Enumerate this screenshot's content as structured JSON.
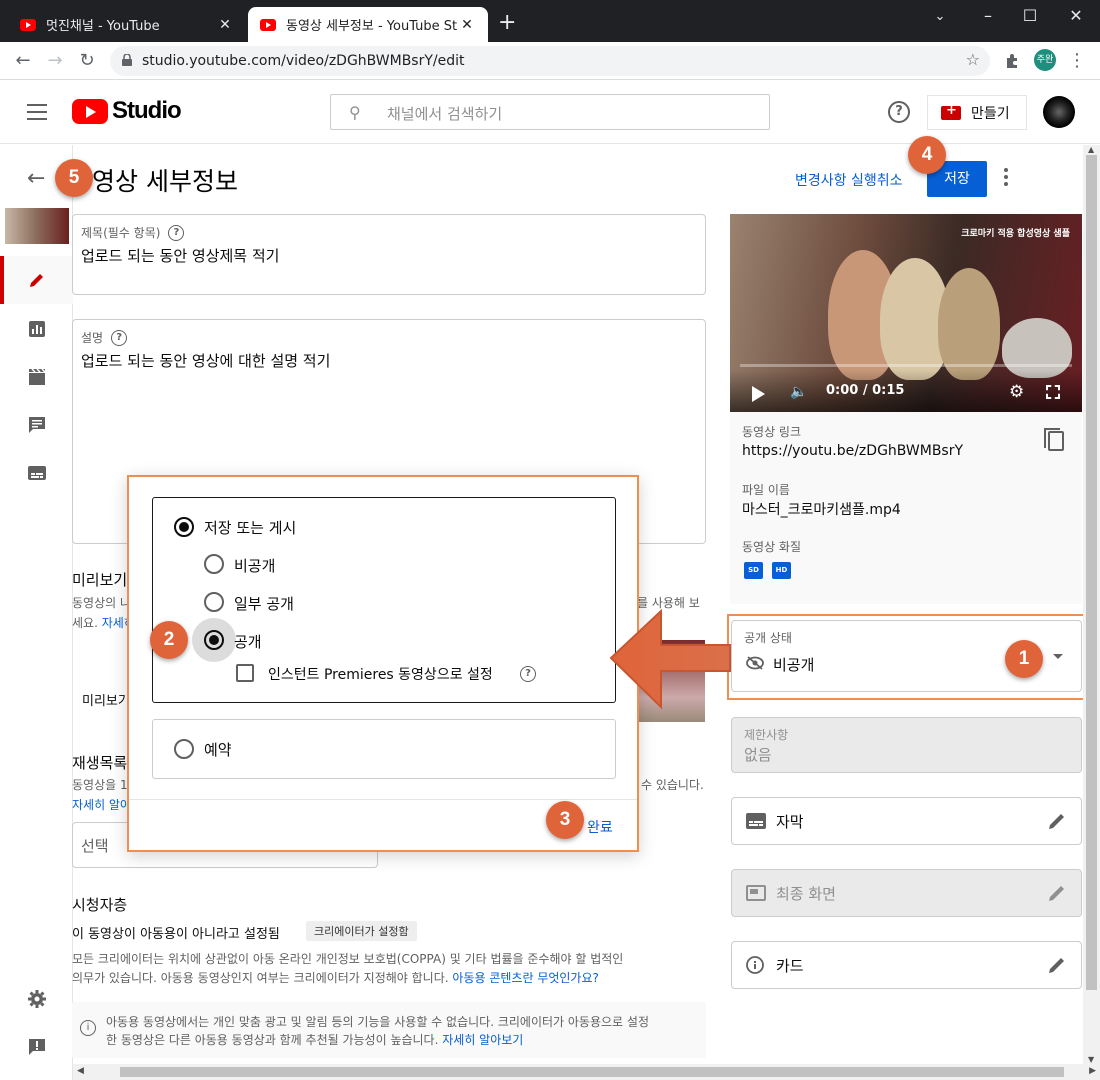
{
  "browser": {
    "tabs": [
      {
        "title": "멋진채널 - YouTube",
        "active": false
      },
      {
        "title": "동영상 세부정보 - YouTube Studio",
        "active": true
      }
    ],
    "url": "studio.youtube.com/video/zDGhBWMBsrY/edit",
    "profile_initials": "주완"
  },
  "header": {
    "logo_text": "Studio",
    "search_placeholder": "채널에서 검색하기",
    "help_icon": "?",
    "create_label": "만들기"
  },
  "page": {
    "title": "영상 세부정보",
    "undo_label": "변경사항 실행취소",
    "save_label": "저장"
  },
  "details": {
    "title_label": "제목(필수 항목)",
    "title_value": "업로드 되는 동안 영상제목 적기",
    "description_label": "설명",
    "description_value": "업로드 되는 동안 영상에 대한 설명 적기"
  },
  "background": {
    "thumbnail_heading_fragment": "미리보기",
    "thumbnail_desc_fragment1": "동영상의 나",
    "thumbnail_desc_fragment2": "를 사용해 보",
    "thumbnail_desc_fragment3": "세요.",
    "thumbnail_learn_fragment": "자세히",
    "thumbnail_preview_fragment": "미리보기",
    "playlist_heading_fragment": "재생목록",
    "playlist_desc_fragment1": "동영상을 1",
    "playlist_desc_fragment2": "수 있습니다.",
    "playlist_learn_fragment": "자세히 알아",
    "playlist_select": "선택",
    "audience_heading_fragment": "시청자층",
    "audience_status": "이 동영상이 아동용이 아니라고 설정됨",
    "audience_chip": "크리에이터가 설정함",
    "audience_desc_line1": "모든 크리에이터는 위치에 상관없이 아동 온라인 개인정보 보호법(COPPA) 및 기타 법률을 준수해야 할 법적인",
    "audience_desc_line2": "의무가 있습니다. 아동용 동영상인지 여부는 크리에이터가 지정해야 합니다.",
    "audience_desc_link": "아동용 콘텐츠란 무엇인가요?",
    "info_line1": "아동용 동영상에서는 개인 맞춤 광고 및 알림 등의 기능을 사용할 수 없습니다. 크리에이터가 아동용으로 설정",
    "info_line2": "한 동영상은 다른 아동용 동영상과 함께 추천될 가능성이 높습니다.",
    "info_link": "자세히 알아보기"
  },
  "video_panel": {
    "overlay_text": "크로마키 적용 합성영상 샘플",
    "time": "0:00 / 0:15",
    "link_label": "동영상 링크",
    "link_value": "https://youtu.be/zDGhBWMBsrY",
    "file_label": "파일 이름",
    "file_value": "마스터_크로마키샘플.mp4",
    "quality_label": "동영상 화질",
    "quality_badges": [
      "SD",
      "HD"
    ]
  },
  "visibility": {
    "label": "공개 상태",
    "value": "비공개"
  },
  "restrictions": {
    "label": "제한사항",
    "value": "없음"
  },
  "cards": [
    {
      "label": "자막",
      "icon": "subtitles-icon",
      "disabled": false
    },
    {
      "label": "최종 화면",
      "icon": "end-screen-icon",
      "disabled": true
    },
    {
      "label": "카드",
      "icon": "info-icon",
      "disabled": false
    }
  ],
  "visibility_menu": {
    "save_or_publish": "저장 또는 게시",
    "private": "비공개",
    "unlisted": "일부 공개",
    "public": "공개",
    "premieres": "인스턴트 Premieres 동영상으로 설정",
    "schedule": "예약",
    "done": "완료"
  },
  "annotations": [
    "1",
    "2",
    "3",
    "4",
    "5"
  ],
  "colors": {
    "accent_blue": "#065fd4",
    "youtube_red": "#ff0000",
    "annotation_orange": "#e0643a",
    "highlight_outline": "#ec8f50"
  }
}
